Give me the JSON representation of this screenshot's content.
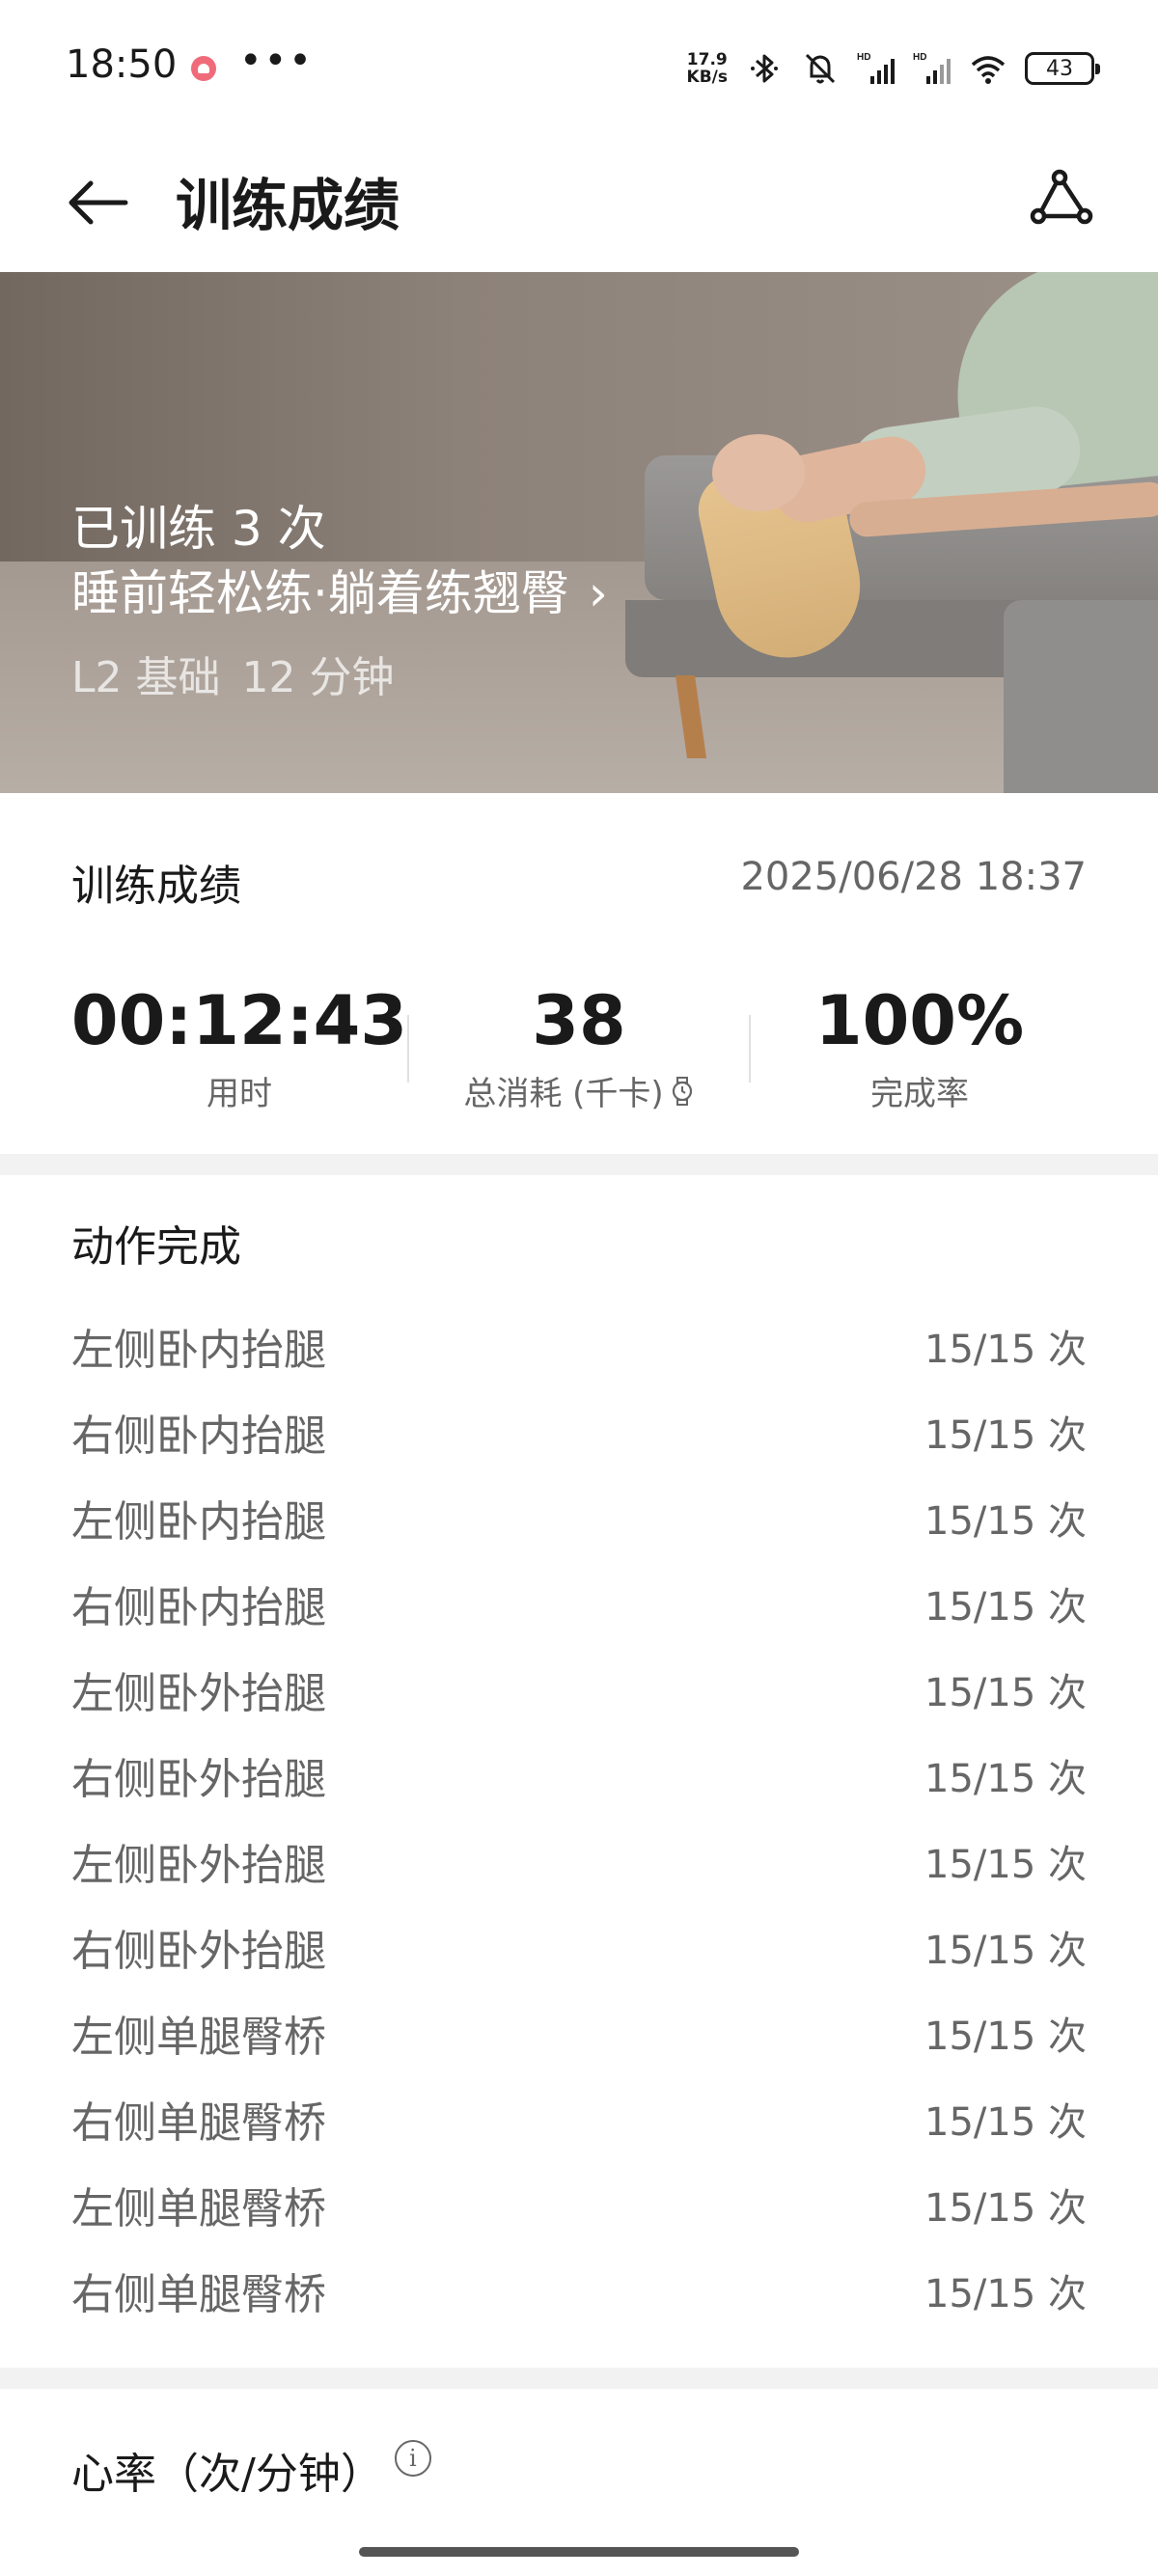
{
  "status_bar": {
    "time": "18:50",
    "dots": "•••",
    "net_speed_value": "17.9",
    "net_speed_unit": "KB/s",
    "battery": "43"
  },
  "app_bar": {
    "title": "训练成绩"
  },
  "hero": {
    "train_count": "已训练 3 次",
    "course_name": "睡前轻松练·躺着练翘臀",
    "chevron": "›",
    "level": "L2 基础",
    "duration": "12 分钟"
  },
  "results": {
    "title": "训练成绩",
    "date": "2025/06/28 18:37",
    "stats": [
      {
        "value": "00:12:43",
        "label": "用时"
      },
      {
        "value": "38",
        "label": "总消耗 (千卡)"
      },
      {
        "value": "100%",
        "label": "完成率"
      }
    ]
  },
  "actions": {
    "title": "动作完成",
    "items": [
      {
        "name": "左侧卧内抬腿",
        "count": "15/15 次"
      },
      {
        "name": "右侧卧内抬腿",
        "count": "15/15 次"
      },
      {
        "name": "左侧卧内抬腿",
        "count": "15/15 次"
      },
      {
        "name": "右侧卧内抬腿",
        "count": "15/15 次"
      },
      {
        "name": "左侧卧外抬腿",
        "count": "15/15 次"
      },
      {
        "name": "右侧卧外抬腿",
        "count": "15/15 次"
      },
      {
        "name": "左侧卧外抬腿",
        "count": "15/15 次"
      },
      {
        "name": "右侧卧外抬腿",
        "count": "15/15 次"
      },
      {
        "name": "左侧单腿臀桥",
        "count": "15/15 次"
      },
      {
        "name": "右侧单腿臀桥",
        "count": "15/15 次"
      },
      {
        "name": "左侧单腿臀桥",
        "count": "15/15 次"
      },
      {
        "name": "右侧单腿臀桥",
        "count": "15/15 次"
      }
    ]
  },
  "heart_rate": {
    "title": "心率（次/分钟）",
    "info_glyph": "i"
  },
  "icons": {
    "back": "arrow-left-icon",
    "share": "share-icon",
    "bluetooth": "bluetooth-icon",
    "mute": "bell-off-icon",
    "signal": "signal-icon",
    "wifi": "wifi-icon",
    "battery": "battery-icon",
    "watch": "watch-icon",
    "info": "info-icon"
  },
  "colors": {
    "text_primary": "#1a1a1a",
    "text_secondary": "#666666",
    "divider": "#f2f2f2",
    "status_heart": "#f06b7a"
  }
}
